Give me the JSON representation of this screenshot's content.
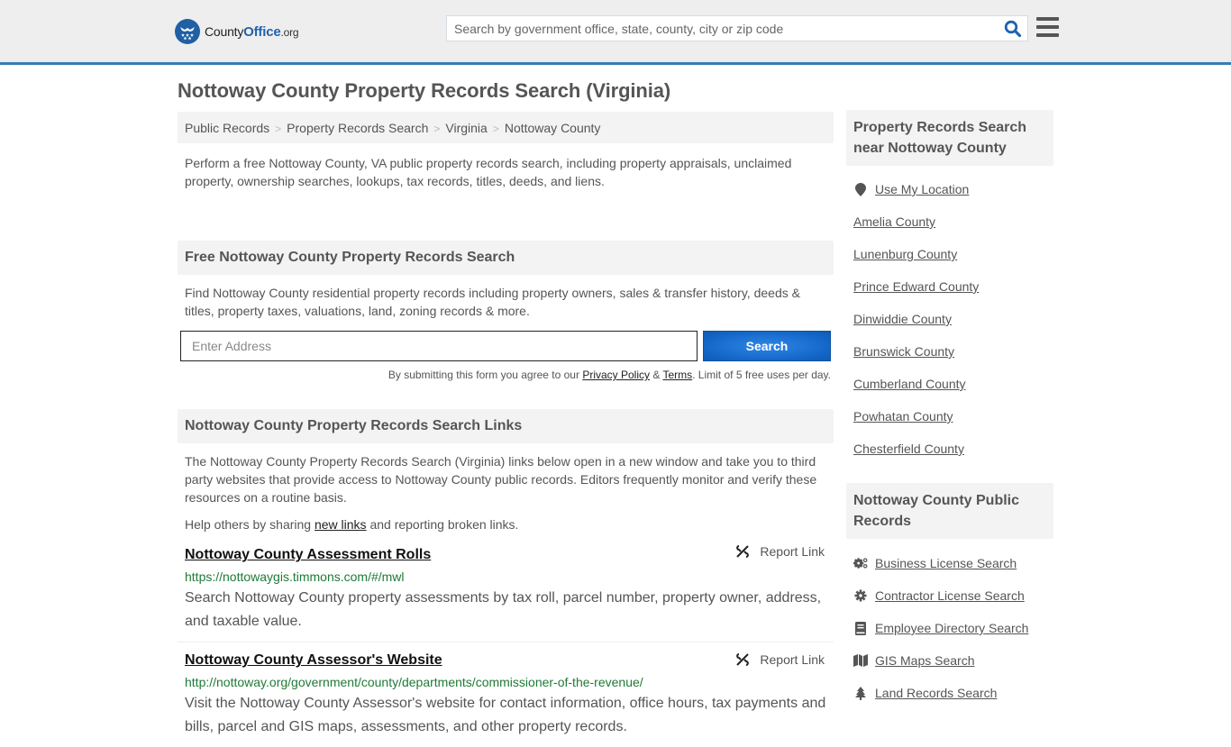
{
  "header": {
    "logo": {
      "county": "County",
      "office": "Office",
      "org": ".org"
    },
    "search_placeholder": "Search by government office, state, county, city or zip code",
    "brand_color": "#1f5fa4",
    "accent_border": "#3b7bad"
  },
  "page_title": "Nottoway County Property Records Search (Virginia)",
  "breadcrumb": [
    {
      "label": "Public Records"
    },
    {
      "label": "Property Records Search"
    },
    {
      "label": "Virginia"
    },
    {
      "label": "Nottoway County"
    }
  ],
  "breadcrumb_sep": ">",
  "intro": "Perform a free Nottoway County, VA public property records search, including property appraisals, unclaimed property, ownership searches, lookups, tax records, titles, deeds, and liens.",
  "free_search": {
    "heading": "Free Nottoway County Property Records Search",
    "description": "Find Nottoway County residential property records including property owners, sales & transfer history, deeds & titles, property taxes, valuations, land, zoning records & more.",
    "address_placeholder": "Enter Address",
    "submit_label": "Search",
    "terms_prefix": "By submitting this form you agree to our ",
    "privacy_label": "Privacy Policy",
    "terms_amp": " & ",
    "terms_label": "Terms",
    "terms_suffix": ". Limit of 5 free uses per day."
  },
  "links_section": {
    "heading": "Nottoway County Property Records Search Links",
    "description": "The Nottoway County Property Records Search (Virginia) links below open in a new window and take you to third party websites that provide access to Nottoway County public records. Editors frequently monitor and verify these resources on a routine basis.",
    "help_prefix": "Help others by sharing ",
    "help_link": "new links",
    "help_suffix": " and reporting broken links.",
    "report_label": "Report Link",
    "results": [
      {
        "title": "Nottoway County Assessment Rolls",
        "url": "https://nottowaygis.timmons.com/#/mwl",
        "description": "Search Nottoway County property assessments by tax roll, parcel number, property owner, address, and taxable value."
      },
      {
        "title": "Nottoway County Assessor's Website",
        "url": "http://nottoway.org/government/county/departments/commissioner-of-the-revenue/",
        "description": "Visit the Nottoway County Assessor's website for contact information, office hours, tax payments and bills, parcel and GIS maps, assessments, and other property records."
      }
    ]
  },
  "sidebar": {
    "nearby": {
      "heading": "Property Records Search near Nottoway County",
      "use_location": "Use My Location",
      "counties": [
        "Amelia County",
        "Lunenburg County",
        "Prince Edward County",
        "Dinwiddie County",
        "Brunswick County",
        "Cumberland County",
        "Powhatan County",
        "Chesterfield County"
      ]
    },
    "public_records": {
      "heading": "Nottoway County Public Records",
      "items": [
        {
          "label": "Business License Search",
          "icon": "cogs-icon"
        },
        {
          "label": "Contractor License Search",
          "icon": "cog-icon"
        },
        {
          "label": "Employee Directory Search",
          "icon": "book-icon"
        },
        {
          "label": "GIS Maps Search",
          "icon": "map-icon"
        },
        {
          "label": "Land Records Search",
          "icon": "tree-icon"
        }
      ]
    }
  }
}
